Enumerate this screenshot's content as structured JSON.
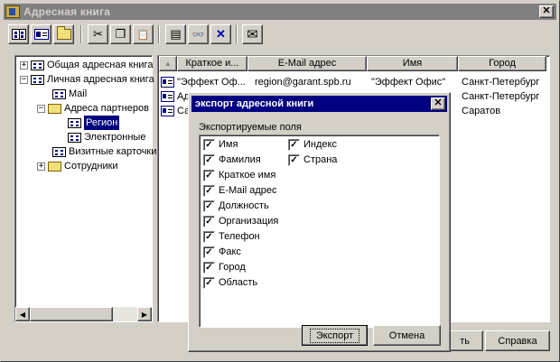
{
  "window": {
    "title": "Адресная книга",
    "close_glyph": "✕"
  },
  "toolbar": {
    "buttons": [
      {
        "name": "address-book-icon"
      },
      {
        "name": "contact-card-icon"
      },
      {
        "name": "folder-icon"
      },
      {
        "name": "cut-icon",
        "glyph": "✂"
      },
      {
        "name": "copy-icon",
        "glyph": "❐"
      },
      {
        "name": "paste-icon",
        "glyph": "📋"
      },
      {
        "name": "properties-icon",
        "glyph": "▤"
      },
      {
        "name": "find-icon",
        "glyph": "👓"
      },
      {
        "name": "delete-icon",
        "glyph": "✕"
      },
      {
        "name": "mail-icon",
        "glyph": "✉"
      }
    ]
  },
  "tree": {
    "items": [
      {
        "label": "Общая адресная книга",
        "expander": "+"
      },
      {
        "label": "Личная адресная книга",
        "expander": "−"
      },
      {
        "label": "Mail"
      },
      {
        "label": "Адреса партнеров",
        "expander": "−"
      },
      {
        "label": "Регион"
      },
      {
        "label": "Электронные"
      },
      {
        "label": "Визитные карточки"
      },
      {
        "label": "Сотрудники",
        "expander": "+"
      }
    ]
  },
  "list": {
    "columns": [
      "",
      "Краткое и...",
      "E-Mail адрес",
      "Имя",
      "Город"
    ],
    "sort_glyph": "▲",
    "rows": [
      {
        "short": "\"Эффект Оф...",
        "email": "region@garant.spb.ru",
        "name": "\"Эффект Офис\"",
        "city": "Санкт-Петербург"
      },
      {
        "short": "Ад",
        "email": "",
        "name": "",
        "city": "Санкт-Петербург"
      },
      {
        "short": "Са",
        "email": "",
        "name": "",
        "city": "Саратов"
      }
    ]
  },
  "buttons": {
    "partial_label": "ть",
    "help_label": "Справка"
  },
  "dialog": {
    "title": "экспорт адресной книги",
    "close_glyph": "✕",
    "fields_label": "Экспортируемые поля",
    "fields_left": [
      "Имя",
      "Фамилия",
      "Краткое имя",
      "E-Mail адрес",
      "Должность",
      "Организация",
      "Телефон",
      "Факс",
      "Город",
      "Область"
    ],
    "fields_right": [
      "Индекс",
      "Страна"
    ],
    "check_glyph": "✓",
    "export_label": "Экспорт",
    "cancel_label": "Отмена"
  }
}
